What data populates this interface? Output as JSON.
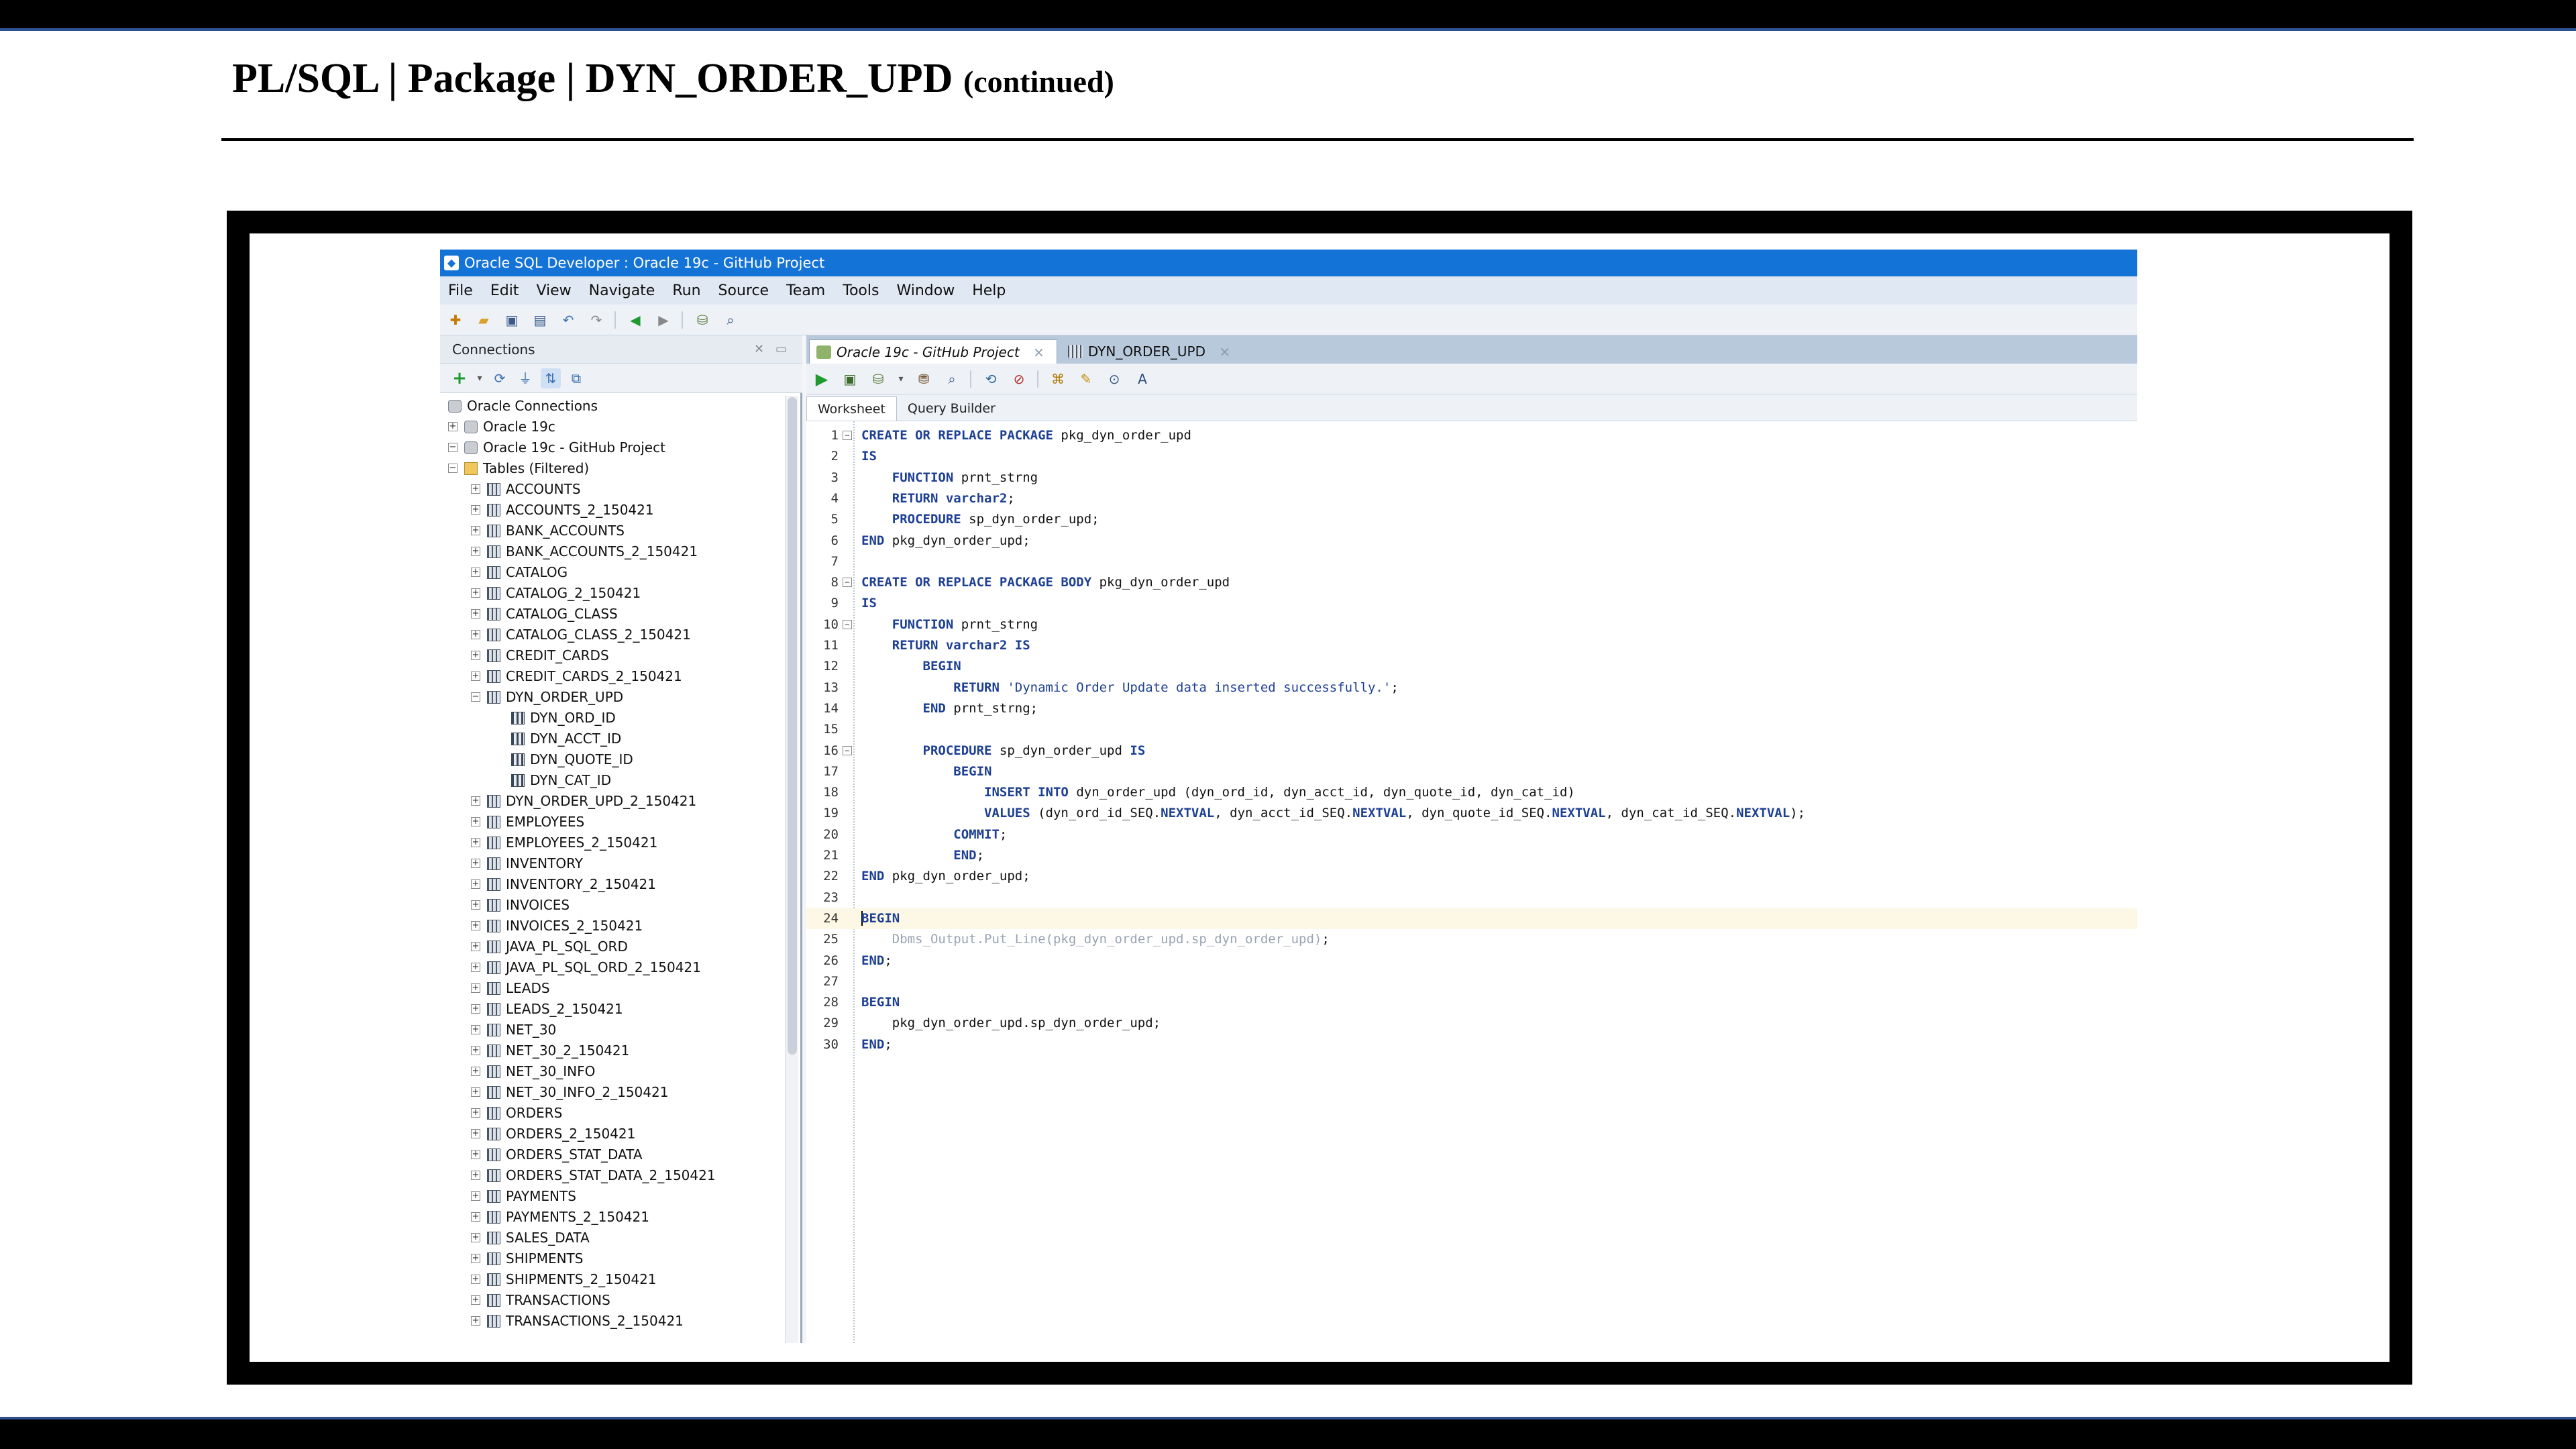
{
  "slide": {
    "title": "PL/SQL | Package | DYN_ORDER_UPD",
    "title_suffix": "(continued)"
  },
  "app": {
    "window_title": "Oracle SQL Developer : Oracle 19c - GitHub Project",
    "menu": [
      "File",
      "Edit",
      "View",
      "Navigate",
      "Run",
      "Source",
      "Team",
      "Tools",
      "Window",
      "Help"
    ]
  },
  "connections": {
    "panel_title": "Connections",
    "tree": [
      {
        "label": "Oracle Connections",
        "level": 0,
        "icon": "db",
        "expand": ""
      },
      {
        "label": "Oracle 19c",
        "level": 1,
        "icon": "db",
        "expand": "+"
      },
      {
        "label": "Oracle 19c - GitHub Project",
        "level": 1,
        "icon": "db",
        "expand": "-"
      },
      {
        "label": "Tables (Filtered)",
        "level": 2,
        "icon": "folder",
        "expand": "-"
      },
      {
        "label": "ACCOUNTS",
        "level": 3,
        "icon": "table",
        "expand": "+"
      },
      {
        "label": "ACCOUNTS_2_150421",
        "level": 3,
        "icon": "table",
        "expand": "+"
      },
      {
        "label": "BANK_ACCOUNTS",
        "level": 3,
        "icon": "table",
        "expand": "+"
      },
      {
        "label": "BANK_ACCOUNTS_2_150421",
        "level": 3,
        "icon": "table",
        "expand": "+"
      },
      {
        "label": "CATALOG",
        "level": 3,
        "icon": "table",
        "expand": "+"
      },
      {
        "label": "CATALOG_2_150421",
        "level": 3,
        "icon": "table",
        "expand": "+"
      },
      {
        "label": "CATALOG_CLASS",
        "level": 3,
        "icon": "table",
        "expand": "+"
      },
      {
        "label": "CATALOG_CLASS_2_150421",
        "level": 3,
        "icon": "table",
        "expand": "+"
      },
      {
        "label": "CREDIT_CARDS",
        "level": 3,
        "icon": "table",
        "expand": "+"
      },
      {
        "label": "CREDIT_CARDS_2_150421",
        "level": 3,
        "icon": "table",
        "expand": "+"
      },
      {
        "label": "DYN_ORDER_UPD",
        "level": 3,
        "icon": "table",
        "expand": "-"
      },
      {
        "label": "DYN_ORD_ID",
        "level": 4,
        "icon": "col",
        "expand": ""
      },
      {
        "label": "DYN_ACCT_ID",
        "level": 4,
        "icon": "col",
        "expand": ""
      },
      {
        "label": "DYN_QUOTE_ID",
        "level": 4,
        "icon": "col",
        "expand": ""
      },
      {
        "label": "DYN_CAT_ID",
        "level": 4,
        "icon": "col",
        "expand": ""
      },
      {
        "label": "DYN_ORDER_UPD_2_150421",
        "level": 3,
        "icon": "table",
        "expand": "+"
      },
      {
        "label": "EMPLOYEES",
        "level": 3,
        "icon": "table",
        "expand": "+"
      },
      {
        "label": "EMPLOYEES_2_150421",
        "level": 3,
        "icon": "table",
        "expand": "+"
      },
      {
        "label": "INVENTORY",
        "level": 3,
        "icon": "table",
        "expand": "+"
      },
      {
        "label": "INVENTORY_2_150421",
        "level": 3,
        "icon": "table",
        "expand": "+"
      },
      {
        "label": "INVOICES",
        "level": 3,
        "icon": "table",
        "expand": "+"
      },
      {
        "label": "INVOICES_2_150421",
        "level": 3,
        "icon": "table",
        "expand": "+"
      },
      {
        "label": "JAVA_PL_SQL_ORD",
        "level": 3,
        "icon": "table",
        "expand": "+"
      },
      {
        "label": "JAVA_PL_SQL_ORD_2_150421",
        "level": 3,
        "icon": "table",
        "expand": "+"
      },
      {
        "label": "LEADS",
        "level": 3,
        "icon": "table",
        "expand": "+"
      },
      {
        "label": "LEADS_2_150421",
        "level": 3,
        "icon": "table",
        "expand": "+"
      },
      {
        "label": "NET_30",
        "level": 3,
        "icon": "table",
        "expand": "+"
      },
      {
        "label": "NET_30_2_150421",
        "level": 3,
        "icon": "table",
        "expand": "+"
      },
      {
        "label": "NET_30_INFO",
        "level": 3,
        "icon": "table",
        "expand": "+"
      },
      {
        "label": "NET_30_INFO_2_150421",
        "level": 3,
        "icon": "table",
        "expand": "+"
      },
      {
        "label": "ORDERS",
        "level": 3,
        "icon": "table",
        "expand": "+"
      },
      {
        "label": "ORDERS_2_150421",
        "level": 3,
        "icon": "table",
        "expand": "+"
      },
      {
        "label": "ORDERS_STAT_DATA",
        "level": 3,
        "icon": "table",
        "expand": "+"
      },
      {
        "label": "ORDERS_STAT_DATA_2_150421",
        "level": 3,
        "icon": "table",
        "expand": "+"
      },
      {
        "label": "PAYMENTS",
        "level": 3,
        "icon": "table",
        "expand": "+"
      },
      {
        "label": "PAYMENTS_2_150421",
        "level": 3,
        "icon": "table",
        "expand": "+"
      },
      {
        "label": "SALES_DATA",
        "level": 3,
        "icon": "table",
        "expand": "+"
      },
      {
        "label": "SHIPMENTS",
        "level": 3,
        "icon": "table",
        "expand": "+"
      },
      {
        "label": "SHIPMENTS_2_150421",
        "level": 3,
        "icon": "table",
        "expand": "+"
      },
      {
        "label": "TRANSACTIONS",
        "level": 3,
        "icon": "table",
        "expand": "+"
      },
      {
        "label": "TRANSACTIONS_2_150421",
        "level": 3,
        "icon": "table",
        "expand": "+"
      }
    ]
  },
  "editor": {
    "tabs": [
      {
        "label": "Oracle 19c - GitHub Project",
        "active": true
      },
      {
        "label": "DYN_ORDER_UPD",
        "active": false
      }
    ],
    "sub_tabs": [
      "Worksheet",
      "Query Builder"
    ],
    "highlight_line": 24,
    "lines": [
      {
        "n": 1,
        "fold": "-",
        "tokens": [
          [
            "kw",
            "CREATE OR REPLACE PACKAGE "
          ],
          [
            "id",
            "pkg_dyn_order_upd"
          ]
        ]
      },
      {
        "n": 2,
        "fold": "",
        "tokens": [
          [
            "kw",
            "IS"
          ]
        ]
      },
      {
        "n": 3,
        "fold": "",
        "tokens": [
          [
            "id",
            "    "
          ],
          [
            "kw",
            "FUNCTION "
          ],
          [
            "id",
            "prnt_strng"
          ]
        ]
      },
      {
        "n": 4,
        "fold": "",
        "tokens": [
          [
            "id",
            "    "
          ],
          [
            "kw",
            "RETURN varchar2"
          ],
          [
            "id",
            ";"
          ]
        ]
      },
      {
        "n": 5,
        "fold": "",
        "tokens": [
          [
            "id",
            "    "
          ],
          [
            "kw",
            "PROCEDURE "
          ],
          [
            "id",
            "sp_dyn_order_upd;"
          ]
        ]
      },
      {
        "n": 6,
        "fold": "",
        "tokens": [
          [
            "kw",
            "END "
          ],
          [
            "id",
            "pkg_dyn_order_upd;"
          ]
        ]
      },
      {
        "n": 7,
        "fold": "",
        "tokens": []
      },
      {
        "n": 8,
        "fold": "-",
        "tokens": [
          [
            "kw",
            "CREATE OR REPLACE PACKAGE BODY "
          ],
          [
            "id",
            "pkg_dyn_order_upd"
          ]
        ]
      },
      {
        "n": 9,
        "fold": "",
        "tokens": [
          [
            "kw",
            "IS"
          ]
        ]
      },
      {
        "n": 10,
        "fold": "-",
        "tokens": [
          [
            "id",
            "    "
          ],
          [
            "kw",
            "FUNCTION "
          ],
          [
            "id",
            "prnt_strng"
          ]
        ]
      },
      {
        "n": 11,
        "fold": "",
        "tokens": [
          [
            "id",
            "    "
          ],
          [
            "kw",
            "RETURN varchar2 IS"
          ]
        ]
      },
      {
        "n": 12,
        "fold": "",
        "tokens": [
          [
            "id",
            "        "
          ],
          [
            "kw",
            "BEGIN"
          ]
        ]
      },
      {
        "n": 13,
        "fold": "",
        "tokens": [
          [
            "id",
            "            "
          ],
          [
            "kw",
            "RETURN "
          ],
          [
            "str",
            "'Dynamic Order Update data inserted successfully.'"
          ],
          [
            "id",
            ";"
          ]
        ]
      },
      {
        "n": 14,
        "fold": "",
        "tokens": [
          [
            "id",
            "        "
          ],
          [
            "kw",
            "END "
          ],
          [
            "id",
            "prnt_strng;"
          ]
        ]
      },
      {
        "n": 15,
        "fold": "",
        "tokens": []
      },
      {
        "n": 16,
        "fold": "-",
        "tokens": [
          [
            "id",
            "        "
          ],
          [
            "kw",
            "PROCEDURE "
          ],
          [
            "id",
            "sp_dyn_order_upd "
          ],
          [
            "kw",
            "IS"
          ]
        ]
      },
      {
        "n": 17,
        "fold": "",
        "tokens": [
          [
            "id",
            "            "
          ],
          [
            "kw",
            "BEGIN"
          ]
        ]
      },
      {
        "n": 18,
        "fold": "",
        "tokens": [
          [
            "id",
            "                "
          ],
          [
            "kw",
            "INSERT INTO "
          ],
          [
            "id",
            "dyn_order_upd (dyn_ord_id, dyn_acct_id, dyn_quote_id, dyn_cat_id)"
          ]
        ]
      },
      {
        "n": 19,
        "fold": "",
        "tokens": [
          [
            "id",
            "                "
          ],
          [
            "kw",
            "VALUES "
          ],
          [
            "id",
            "(dyn_ord_id_SEQ."
          ],
          [
            "kw",
            "NEXTVAL"
          ],
          [
            "id",
            ", dyn_acct_id_SEQ."
          ],
          [
            "kw",
            "NEXTVAL"
          ],
          [
            "id",
            ", dyn_quote_id_SEQ."
          ],
          [
            "kw",
            "NEXTVAL"
          ],
          [
            "id",
            ", dyn_cat_id_SEQ."
          ],
          [
            "kw",
            "NEXTVAL"
          ],
          [
            "id",
            ");"
          ]
        ]
      },
      {
        "n": 20,
        "fold": "",
        "tokens": [
          [
            "id",
            "            "
          ],
          [
            "kw",
            "COMMIT"
          ],
          [
            "id",
            ";"
          ]
        ]
      },
      {
        "n": 21,
        "fold": "",
        "tokens": [
          [
            "id",
            "            "
          ],
          [
            "kw",
            "END"
          ],
          [
            "id",
            ";"
          ]
        ]
      },
      {
        "n": 22,
        "fold": "",
        "tokens": [
          [
            "kw",
            "END "
          ],
          [
            "id",
            "pkg_dyn_order_upd;"
          ]
        ]
      },
      {
        "n": 23,
        "fold": "",
        "tokens": []
      },
      {
        "n": 24,
        "fold": "",
        "tokens": [
          [
            "kw",
            "BEGIN"
          ]
        ]
      },
      {
        "n": 25,
        "fold": "",
        "tokens": [
          [
            "id",
            "    "
          ],
          [
            "cm",
            "Dbms_Output.Put_Line(pkg_dyn_order_upd.sp_dyn_order_upd)"
          ],
          [
            "id",
            ";"
          ]
        ]
      },
      {
        "n": 26,
        "fold": "",
        "tokens": [
          [
            "kw",
            "END"
          ],
          [
            "id",
            ";"
          ]
        ]
      },
      {
        "n": 27,
        "fold": "",
        "tokens": []
      },
      {
        "n": 28,
        "fold": "",
        "tokens": [
          [
            "kw",
            "BEGIN"
          ]
        ]
      },
      {
        "n": 29,
        "fold": "",
        "tokens": [
          [
            "id",
            "    pkg_dyn_order_upd.sp_dyn_order_upd;"
          ]
        ]
      },
      {
        "n": 30,
        "fold": "",
        "tokens": [
          [
            "kw",
            "END"
          ],
          [
            "id",
            ";"
          ]
        ]
      }
    ]
  }
}
